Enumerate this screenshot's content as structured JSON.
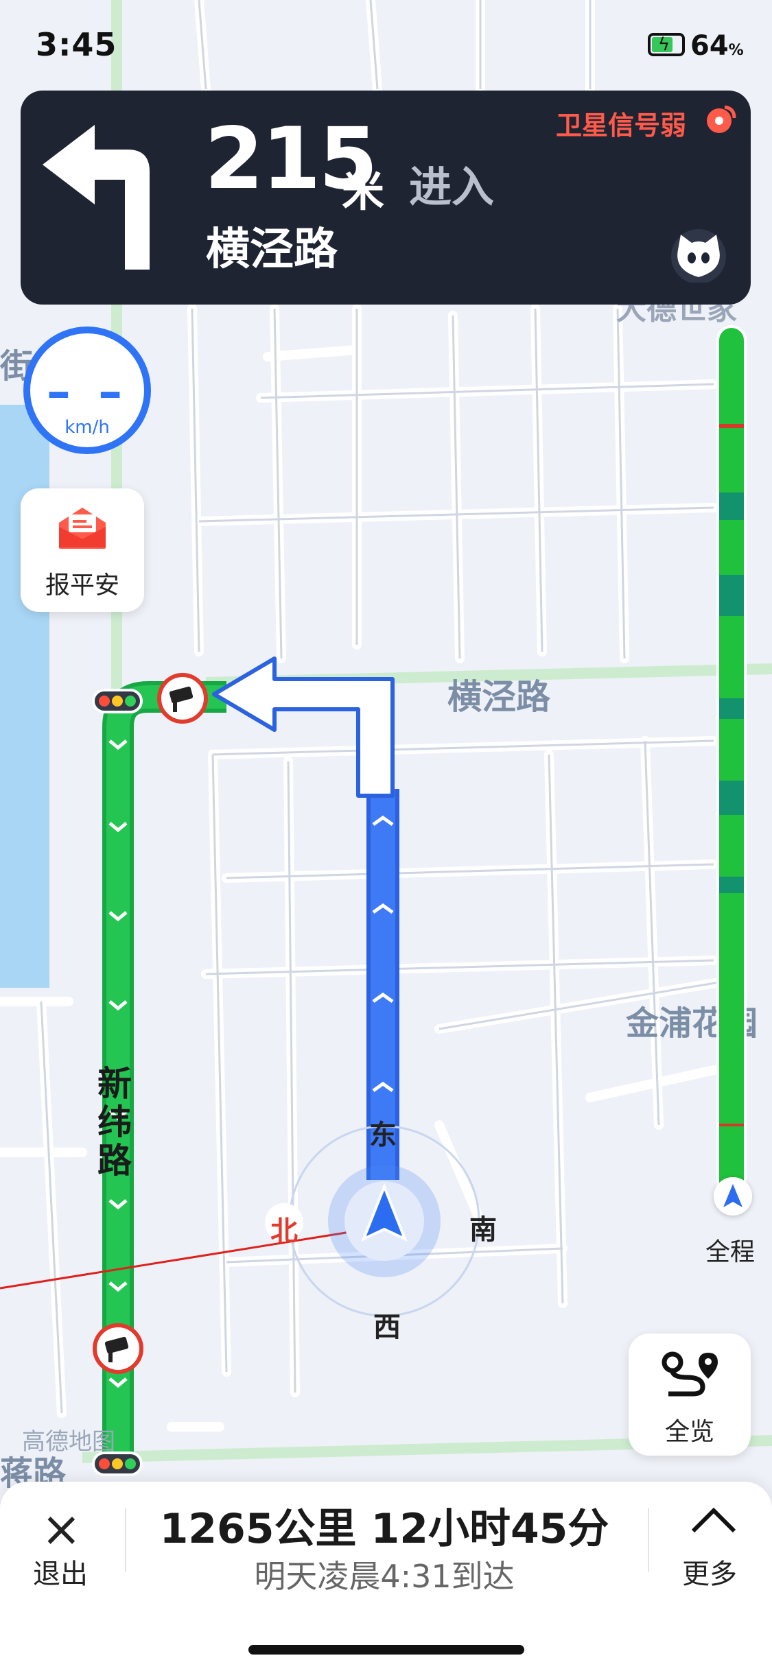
{
  "status_bar": {
    "time": "3:45",
    "battery_percent": "64",
    "battery_unit": "%"
  },
  "nav": {
    "distance": "215",
    "distance_unit": "米",
    "action": "进入",
    "next_road": "横泾路",
    "gps_warning": "卫星信号弱"
  },
  "speed": {
    "value": "– –",
    "unit": "km/h"
  },
  "safe_report": {
    "label": "报平安"
  },
  "map": {
    "road_labels": {
      "hengjing": "横泾路",
      "xinwei": "新纬路",
      "jinpu": "金浦花园",
      "dade": "大德世家",
      "partial_left": "街",
      "partial_bottom": "蒋路"
    },
    "compass": {
      "east": "东",
      "south": "南",
      "west": "西",
      "north": "北"
    },
    "watermark": "高德地图"
  },
  "route_progress": {
    "label": "全程"
  },
  "overview": {
    "label": "全览"
  },
  "bottom": {
    "exit_icon": "×",
    "exit_label": "退出",
    "trip_summary": "1265公里 12小时45分",
    "arrival": "明天凌晨4:31到达",
    "more_label": "更多"
  },
  "colors": {
    "route_blue": "#3e7af5",
    "route_green": "#1fb84a",
    "card_dark": "#1f2433",
    "warning": "#ff5a4a"
  }
}
